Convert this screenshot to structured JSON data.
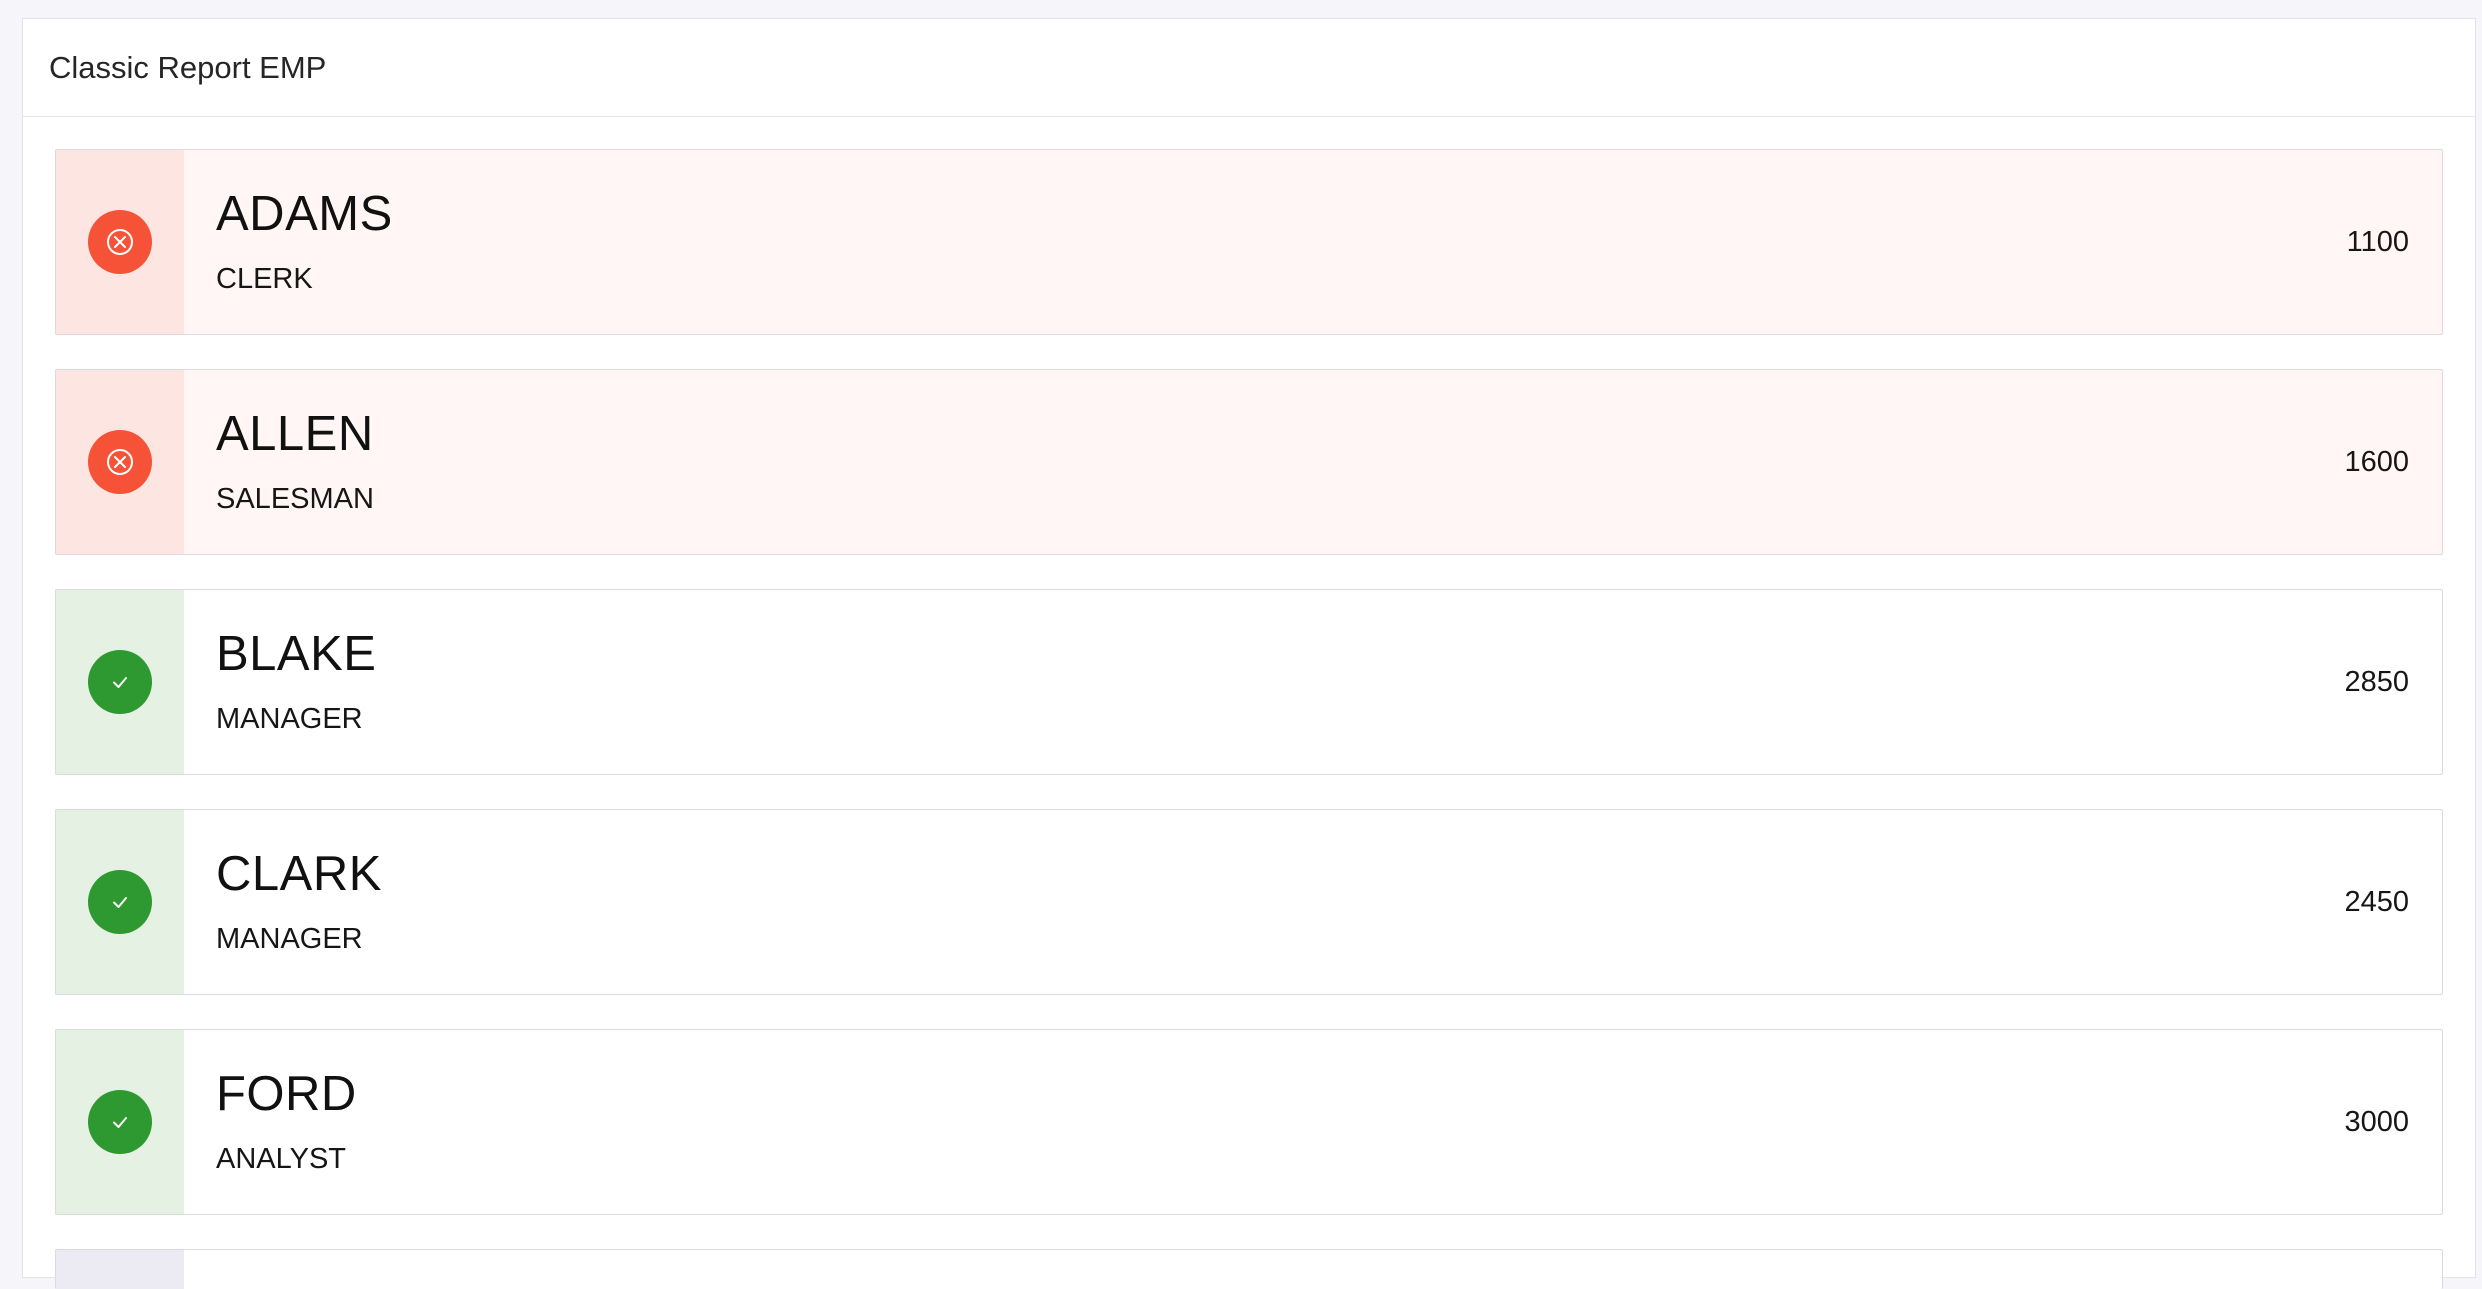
{
  "region": {
    "title": "Classic Report EMP"
  },
  "employees": [
    {
      "name": "ADAMS",
      "job": "CLERK",
      "sal": "1100",
      "status": "danger",
      "icon": "circle-x-icon"
    },
    {
      "name": "ALLEN",
      "job": "SALESMAN",
      "sal": "1600",
      "status": "danger",
      "icon": "circle-x-icon"
    },
    {
      "name": "BLAKE",
      "job": "MANAGER",
      "sal": "2850",
      "status": "success",
      "icon": "check-icon"
    },
    {
      "name": "CLARK",
      "job": "MANAGER",
      "sal": "2450",
      "status": "success",
      "icon": "check-icon"
    },
    {
      "name": "FORD",
      "job": "ANALYST",
      "sal": "3000",
      "status": "success",
      "icon": "check-icon"
    }
  ],
  "colors": {
    "danger": "#f55237",
    "danger_bg": "#fde6e2",
    "success": "#2e9930",
    "success_bg": "#e5f1e3"
  }
}
